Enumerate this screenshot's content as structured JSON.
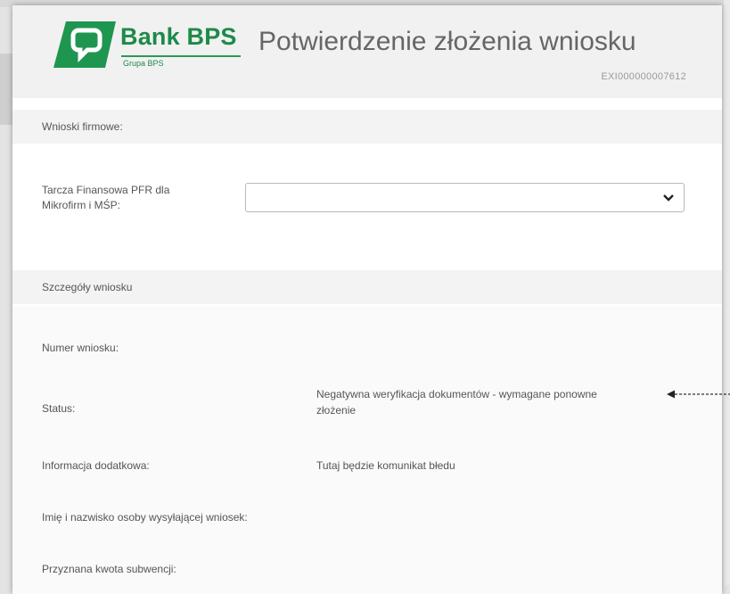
{
  "header": {
    "logo": {
      "brand": "Bank BPS",
      "group": "Grupa BPS",
      "icon": "bank-bps-logo-icon",
      "color": "#1e8a49"
    },
    "title": "Potwierdzenie złożenia wniosku",
    "reference_number": "EXI000000007612"
  },
  "company_section": {
    "heading": "Wnioski firmowe:",
    "field_label_line1": "Tarcza Finansowa PFR dla",
    "field_label_line2": "Mikrofirm i MŚP:",
    "select_value": "",
    "select_icon": "chevron-down-icon"
  },
  "details_section": {
    "heading": "Szczegóły wniosku",
    "rows": [
      {
        "label": "Numer wniosku:",
        "value": ""
      },
      {
        "label": "Status:",
        "value_line1": "Negatywna weryfikacja dokumentów - wymagane ponowne",
        "value_line2": "złożenie"
      },
      {
        "label": "Informacja dodatkowa:",
        "value": "Tutaj będzie komunikat błedu"
      },
      {
        "label": "Imię i nazwisko osoby wysyłającej wniosek:",
        "value": ""
      },
      {
        "label": "Przyznana kwota subwencji:",
        "value": ""
      }
    ]
  },
  "annotation": {
    "icon": "arrow-left-icon"
  }
}
